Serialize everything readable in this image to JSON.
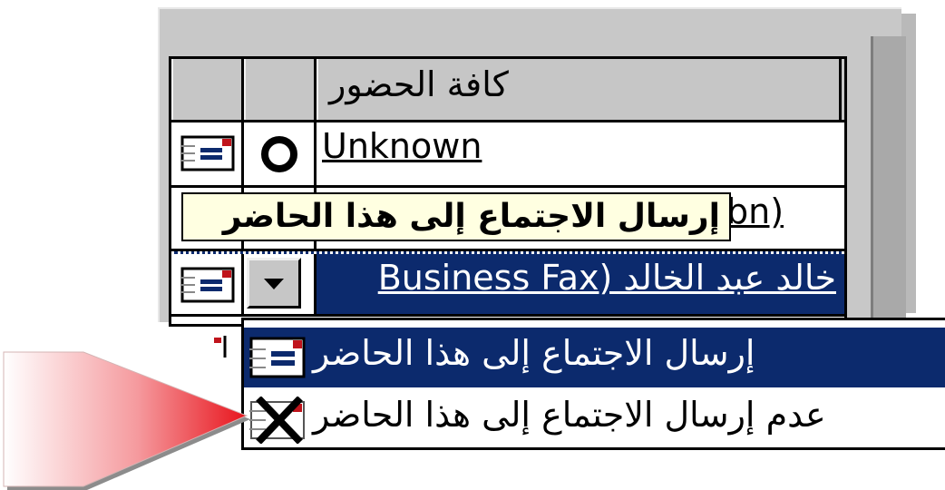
{
  "header": {
    "attendees_label": "كافة الحضور"
  },
  "rows": [
    {
      "name": "Unknown"
    },
    {
      "name_partial": "bn)"
    },
    {
      "name": "خالد عبد الخالد (Business Fax"
    }
  ],
  "tooltip": {
    "text": "إرسال الاجتماع إلى هذا الحاضر"
  },
  "menu": {
    "items": [
      {
        "label": "إرسال الاجتماع إلى هذا الحاضر",
        "icon": "envelope-icon",
        "selected": true
      },
      {
        "label": "عدم إرسال الاجتماع إلى هذا الحاضر",
        "icon": "envelope-crossed-icon",
        "selected": false
      }
    ]
  },
  "colors": {
    "selection": "#0c2a6d",
    "tooltip": "#ffffe1",
    "pointer": "#e8141c"
  }
}
